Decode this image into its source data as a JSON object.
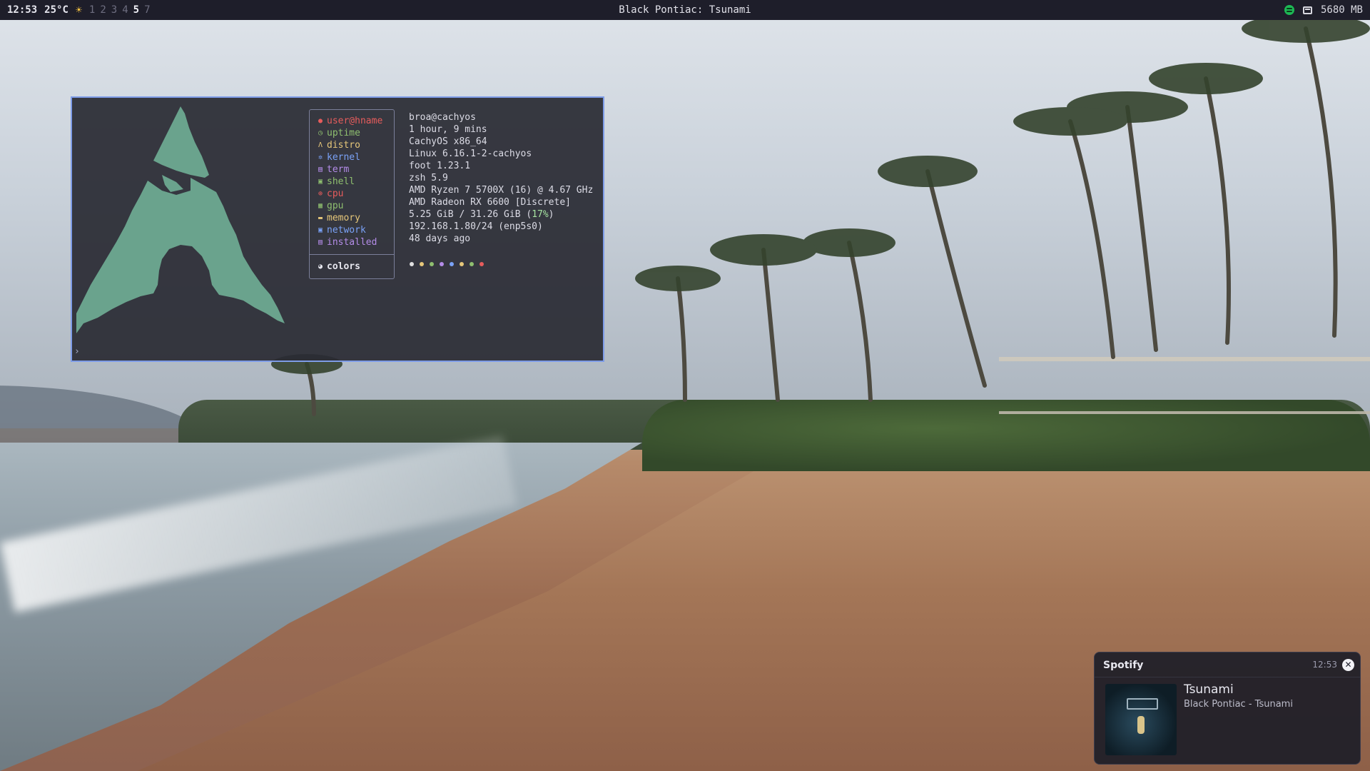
{
  "topbar": {
    "clock": "12:53",
    "temperature": "25°C",
    "workspaces": [
      "1",
      "2",
      "3",
      "4",
      "5",
      "7"
    ],
    "active_workspace": "5",
    "window_title": "Black Pontiac: Tsunami",
    "memory": "5680 MB"
  },
  "terminal": {
    "prompt": "›",
    "info": [
      {
        "key": "user@hname",
        "value": "broa@cachyos",
        "icon": "user-icon",
        "color": "#e65c5c"
      },
      {
        "key": "uptime",
        "value": "1 hour, 9 mins",
        "icon": "clock-icon",
        "color": "#8fbf6f"
      },
      {
        "key": "distro",
        "value": "CachyOS x86_64",
        "icon": "arch-icon",
        "color": "#e6c77a"
      },
      {
        "key": "kernel",
        "value": "Linux 6.16.1-2-cachyos",
        "icon": "gear-icon",
        "color": "#7aa2f7"
      },
      {
        "key": "term",
        "value": "foot 1.23.1",
        "icon": "terminal-icon",
        "color": "#b48ce8"
      },
      {
        "key": "shell",
        "value": "zsh 5.9",
        "icon": "shell-icon",
        "color": "#8fbf6f"
      },
      {
        "key": "cpu",
        "value": "AMD Ryzen 7 5700X (16) @ 4.67 GHz",
        "icon": "cpu-icon",
        "color": "#e65c5c"
      },
      {
        "key": "gpu",
        "value": "AMD Radeon RX 6600 [Discrete]",
        "icon": "gpu-icon",
        "color": "#8fbf6f"
      },
      {
        "key": "memory",
        "value_main": "5.25 GiB / 31.26 GiB (",
        "value_pct": "17%",
        "value_end": ")",
        "icon": "memory-icon",
        "color": "#e6c77a"
      },
      {
        "key": "network",
        "value": "192.168.1.80/24 (enp5s0)",
        "icon": "network-icon",
        "color": "#7aa2f7"
      },
      {
        "key": "installed",
        "value": "48 days ago",
        "icon": "package-icon",
        "color": "#b48ce8"
      }
    ],
    "colors_label": "colors",
    "palette": [
      "#e0e0e0",
      "#e6c77a",
      "#8fbf6f",
      "#b48ce8",
      "#7aa2f7",
      "#e6c77a",
      "#8fbf6f",
      "#e65c5c"
    ],
    "logo_color": "#6aa38d"
  },
  "notification": {
    "app": "Spotify",
    "time": "12:53",
    "close": "✕",
    "title": "Tsunami",
    "subtitle": "Black Pontiac - Tsunami"
  }
}
